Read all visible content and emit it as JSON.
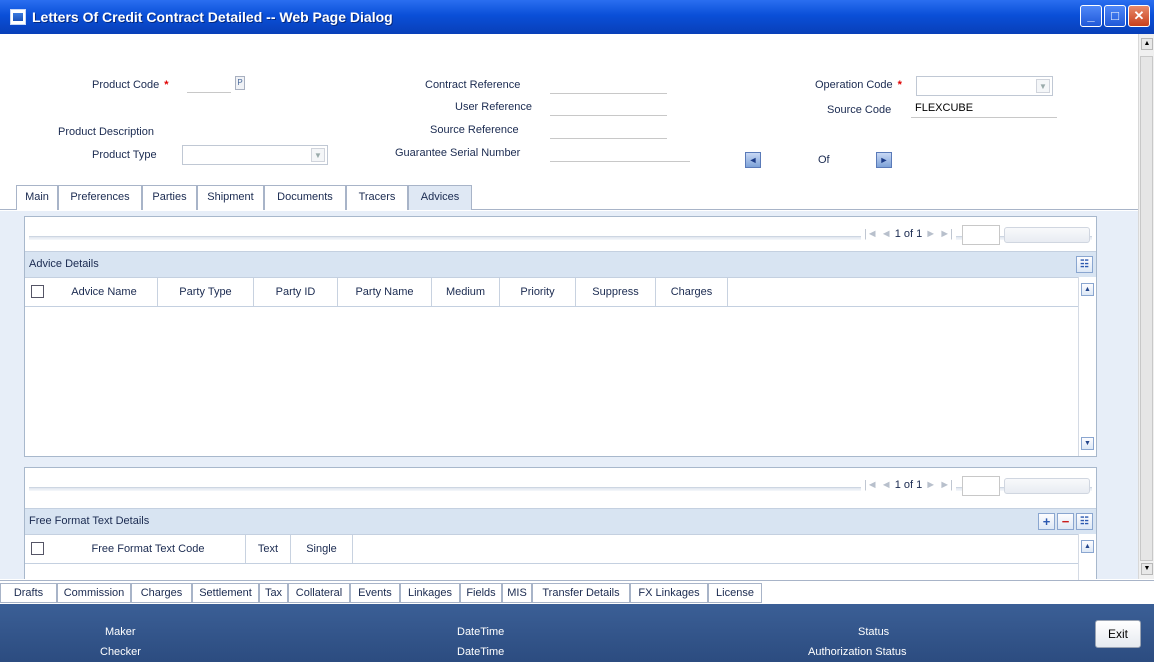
{
  "window": {
    "title": "Letters Of Credit Contract Detailed -- Web Page Dialog",
    "minimize": "_",
    "maximize": "□",
    "close": "✕"
  },
  "header": {
    "product_code_label": "Product Code",
    "product_code_value": "",
    "lov_glyph": "P",
    "product_description_label": "Product Description",
    "product_type_label": "Product Type",
    "contract_reference_label": "Contract Reference",
    "user_reference_label": "User Reference",
    "source_reference_label": "Source Reference",
    "guarantee_serial_label": "Guarantee Serial Number",
    "operation_code_label": "Operation Code",
    "source_code_label": "Source Code",
    "source_code_value": "FLEXCUBE",
    "of_label": "Of",
    "required_marker": "*"
  },
  "tabs": [
    "Main",
    "Preferences",
    "Parties",
    "Shipment",
    "Documents",
    "Tracers",
    "Advices"
  ],
  "active_tab": "Advices",
  "advice_section": {
    "pager": {
      "first": "|◄",
      "prev": "◄",
      "text": "1 of 1",
      "next": "►",
      "last": "►|"
    },
    "title": "Advice Details",
    "columns": [
      "Advice Name",
      "Party Type",
      "Party ID",
      "Party Name",
      "Medium",
      "Priority",
      "Suppress",
      "Charges"
    ]
  },
  "ff_section": {
    "pager": {
      "first": "|◄",
      "prev": "◄",
      "text": "1 of 1",
      "next": "►",
      "last": "►|"
    },
    "title": "Free Format Text Details",
    "add": "+",
    "remove": "−",
    "columns": [
      "Free Format Text Code",
      "Text",
      "Single"
    ]
  },
  "bottom_tabs": [
    "Drafts",
    "Commission",
    "Charges",
    "Settlement",
    "Tax",
    "Collateral",
    "Events",
    "Linkages",
    "Fields",
    "MIS",
    "Transfer Details",
    "FX Linkages",
    "License"
  ],
  "footer": {
    "maker": "Maker",
    "checker": "Checker",
    "datetime1": "DateTime",
    "datetime2": "DateTime",
    "status": "Status",
    "auth_status": "Authorization Status",
    "exit": "Exit"
  },
  "colors": {
    "titlebar": "#0a4fd8",
    "footer": "#34558a",
    "required": "#e00000"
  }
}
